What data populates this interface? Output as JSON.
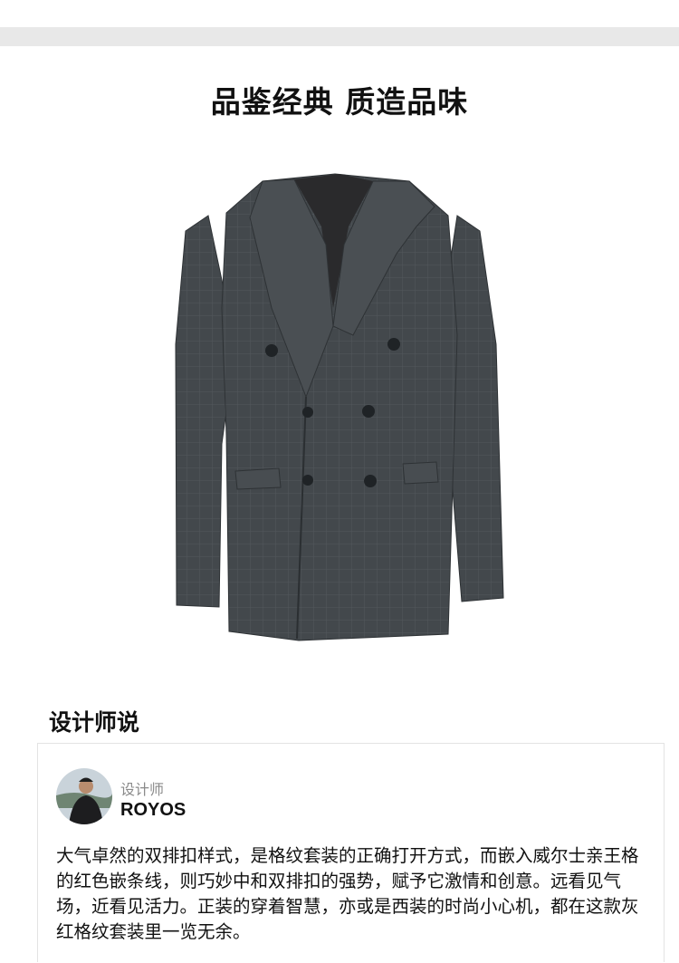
{
  "headline": "品鉴经典  质造品味",
  "product_image": {
    "icon": "suit-jacket-image",
    "color": "#3f4448"
  },
  "designer_section": {
    "title": "设计师说",
    "role_label": "设计师",
    "name": "ROYOS",
    "description": "大气卓然的双排扣样式，是格纹套装的正确打开方式，而嵌入威尔士亲王格的红色嵌条线，则巧妙中和双排扣的强势，赋予它激情和创意。远看见气场，近看见活力。正装的穿着智慧，亦或是西装的时尚小心机，都在这款灰红格纹套装里一览无余。"
  }
}
